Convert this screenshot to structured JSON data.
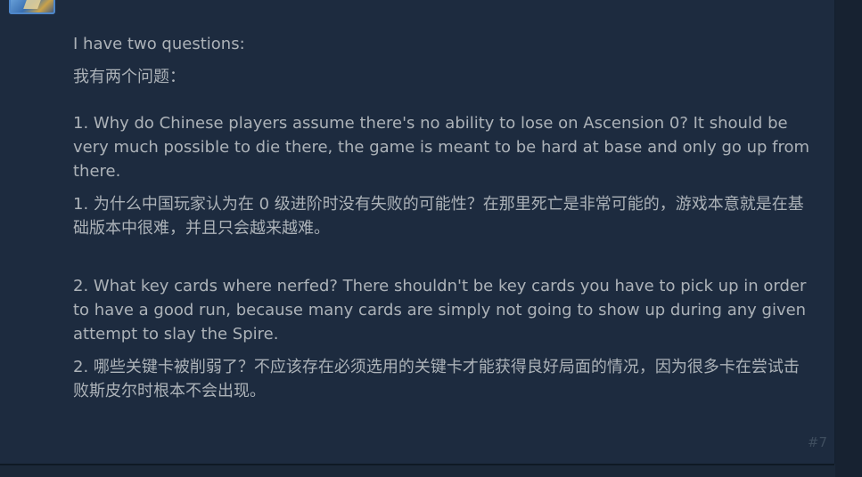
{
  "post": {
    "intro_en": "I have two questions:",
    "intro_cn": "我有两个问题：",
    "q1_en": "1. Why do Chinese players assume there's no ability to lose on Ascension 0? It should be very much possible to die there, the game is meant to be hard at base and only go up from there.",
    "q1_cn": "1. 为什么中国玩家认为在 0 级进阶时没有失败的可能性？在那里死亡是非常可能的，游戏本意就是在基础版本中很难，并且只会越来越难。",
    "q2_en": "2. What key cards where nerfed? There shouldn't be key cards you have to pick up in order to have a good run, because many cards are simply not going to show up during any given attempt to slay the Spire.",
    "q2_cn": "2. 哪些关键卡被削弱了？不应该存在必须选用的关键卡才能获得良好局面的情况，因为很多卡在尝试击败斯皮尔时根本不会出现。",
    "number": "#7"
  },
  "colors": {
    "background": "#1b2838",
    "post_background": "#1d2b3f",
    "text": "#acb2b8",
    "muted": "#3e4d5e"
  }
}
